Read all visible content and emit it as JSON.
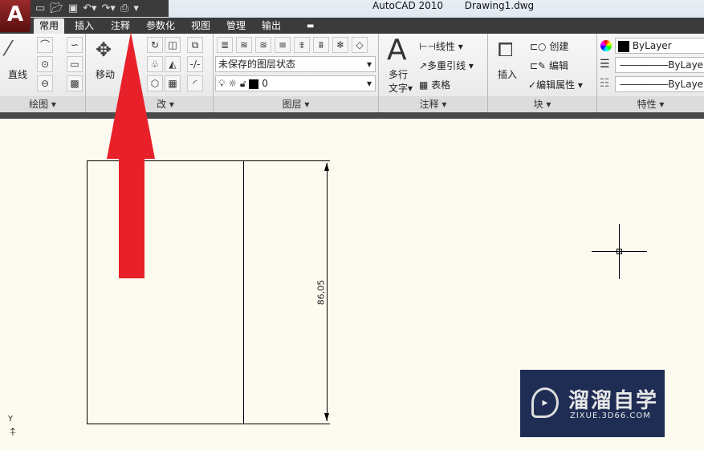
{
  "titlebar": {
    "app": "AutoCAD 2010",
    "document": "Drawing1.dwg"
  },
  "app_button": "A",
  "quick_access": [
    "new-file-icon",
    "open-icon",
    "save-icon",
    "undo-icon",
    "redo-icon",
    "print-icon",
    "dropdown-icon"
  ],
  "tabs": [
    "常用",
    "插入",
    "注释",
    "参数化",
    "视图",
    "管理",
    "输出"
  ],
  "panels": {
    "draw": {
      "label": "绘图",
      "line": "直线"
    },
    "modify": {
      "label": "修改",
      "move": "移动",
      "visible_label": "改"
    },
    "layers": {
      "label": "图层",
      "layer_state": "未保存的图层状态",
      "current_layer": "0"
    },
    "annotation": {
      "label": "注释",
      "mtext_1": "多行",
      "mtext_2": "文字",
      "linear": "线性",
      "mleader": "多重引线",
      "table": "表格"
    },
    "block": {
      "label": "块",
      "insert": "插入",
      "create": "创建",
      "edit": "编辑",
      "edit_attr": "编辑属性"
    },
    "properties": {
      "label": "特性",
      "color": "ByLayer",
      "linetype": "ByLayer",
      "lineweight": "ByLayer"
    }
  },
  "drawing": {
    "dimension": "86,05",
    "ucs_y": "Y"
  },
  "watermark": {
    "name": "溜溜自学",
    "url": "ZIXUE.3D66.COM"
  },
  "colors": {
    "arrow": "#e8202a",
    "canvas": "#fdfbf0",
    "tabbar": "#3b3b3b"
  }
}
